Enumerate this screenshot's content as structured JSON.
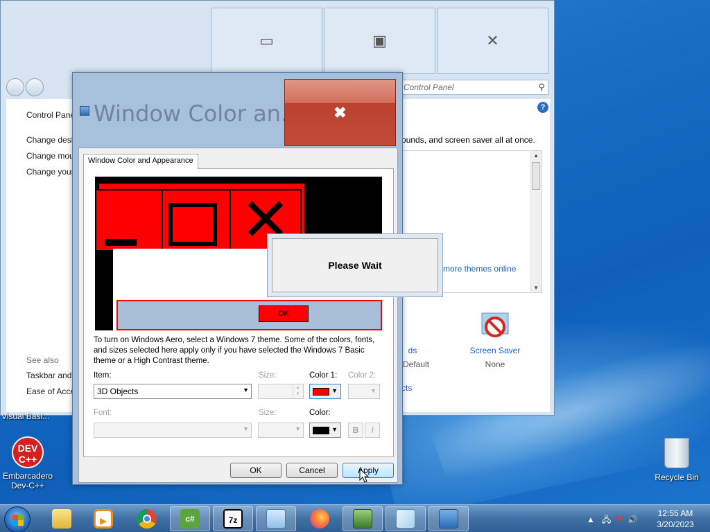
{
  "control_panel": {
    "search_placeholder": "ch Control Panel",
    "sidebar": [
      "Control Pane",
      "Change desk",
      "Change mou",
      "Change your"
    ],
    "see_also_label": "See also",
    "see_also": [
      "Taskbar and",
      "Ease of Acce"
    ],
    "description": "ounds, and screen saver all at once.",
    "more_themes_link": "more themes online",
    "sounds_title": "ds",
    "sounds_value": "Default",
    "screen_saver_title": "Screen Saver",
    "screen_saver_value": "None",
    "fix_link": "cts",
    "caption_buttons": [
      "minimize",
      "maximize",
      "close"
    ]
  },
  "dialog": {
    "title": "Window Color an...",
    "close_glyph": "✖",
    "tab": "Window Color and Appearance",
    "preview_ok": "OK",
    "description": "To turn on Windows Aero, select a Windows 7 theme.  Some of the colors, fonts, and sizes selected here apply only if you have selected the Windows 7 Basic theme or a High Contrast theme.",
    "item_label": "Item:",
    "item_value": "3D Objects",
    "size_label": "Size:",
    "color1_label": "Color 1:",
    "color2_label": "Color 2:",
    "font_label": "Font:",
    "font_size_label": "Size:",
    "font_color_label": "Color:",
    "bold_label": "B",
    "italic_label": "I",
    "color1_value": "#ff0000",
    "font_color_value": "#000000",
    "ok_label": "OK",
    "cancel_label": "Cancel",
    "apply_label": "Apply"
  },
  "wait_dialog": {
    "message": "Please Wait"
  },
  "desktop": {
    "visual_basic_label": "Visual Basi...",
    "dev_logo": "DEV C++",
    "dev_label": "Embarcadero Dev-C++",
    "recycle_label": "Recycle Bin"
  },
  "taskbar": {
    "apps": [
      "explorer-icon",
      "media-player-icon",
      "chrome-icon",
      "csharp-icon",
      "7zip-icon",
      "control-panel-icon",
      "firefox-icon",
      "network-icon",
      "paint-icon",
      "display-icon"
    ],
    "csharp_text": "c#",
    "zip_text": "7z",
    "time": "12:55 AM",
    "date": "3/20/2023"
  }
}
